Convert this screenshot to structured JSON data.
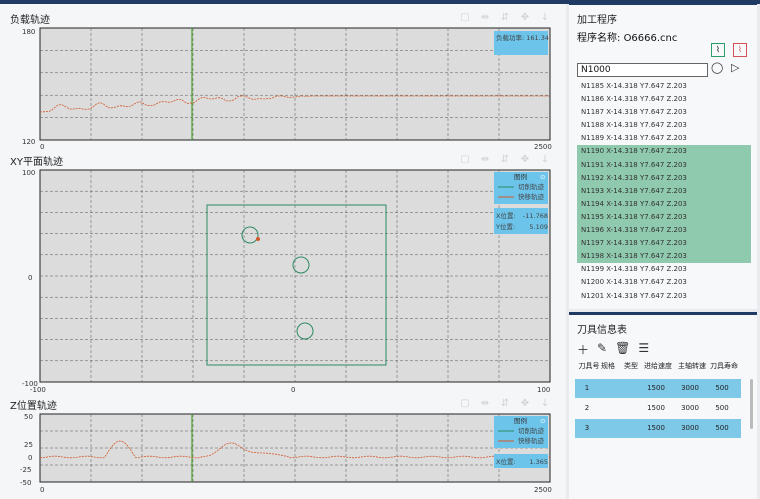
{
  "charts": [
    {
      "title": "负载轨迹",
      "ymax": "180",
      "ymin": "120",
      "xmin": "0",
      "xmax": "2500",
      "readout": "负载功率: 161.34"
    },
    {
      "title": "XY平面轨迹",
      "ymax": "100",
      "ymid": "0",
      "ymin": "-100",
      "xmin": "-100",
      "xmid": "0",
      "xmax": "100",
      "legend_title": "图例",
      "legend_cut": "切削轨迹",
      "legend_fast": "快移轨迹",
      "x_label": "X位置:",
      "x_value": "-11.768",
      "y_label": "Y位置:",
      "y_value": "5.109"
    },
    {
      "title": "Z位置轨迹",
      "ymax": "50",
      "y25": "25",
      "y0": "0",
      "yn25": "-25",
      "ymin": "-50",
      "xmin": "0",
      "xmax": "2500",
      "legend_title": "图例",
      "legend_cut": "切削轨迹",
      "legend_fast": "快移轨迹",
      "x_label": "X位置:",
      "x_value": "1.365"
    }
  ],
  "program": {
    "title": "加工程序",
    "name_label": "程序名称:",
    "name": "O6666.cnc",
    "search_value": "N1000",
    "lines": [
      {
        "text": "N1185 X-14.318 Y7.647 Z.203",
        "hl": false
      },
      {
        "text": "N1186 X-14.318 Y7.647 Z.203",
        "hl": false
      },
      {
        "text": "N1187 X-14.318 Y7.647 Z.203",
        "hl": false
      },
      {
        "text": "N1188 X-14.318 Y7.647 Z.203",
        "hl": false
      },
      {
        "text": "N1189 X-14.318 Y7.647 Z.203",
        "hl": false
      },
      {
        "text": "N1190 X-14.318 Y7.647 Z.203",
        "hl": true
      },
      {
        "text": "N1191 X-14.318 Y7.647 Z.203",
        "hl": true
      },
      {
        "text": "N1192 X-14.318 Y7.647 Z.203",
        "hl": true
      },
      {
        "text": "N1193 X-14.318 Y7.647 Z.203",
        "hl": true
      },
      {
        "text": "N1194 X-14.318 Y7.647 Z.203",
        "hl": true
      },
      {
        "text": "N1195 X-14.318 Y7.647 Z.203",
        "hl": true
      },
      {
        "text": "N1196 X-14.318 Y7.647 Z.203",
        "hl": true
      },
      {
        "text": "N1197 X-14.318 Y7.647 Z.203",
        "hl": true
      },
      {
        "text": "N1198 X-14.318 Y7.647 Z.203",
        "hl": true
      },
      {
        "text": "N1199 X-14.318 Y7.647 Z.203",
        "hl": false
      },
      {
        "text": "N1200 X-14.318 Y7.647 Z.203",
        "hl": false
      },
      {
        "text": "N1201 X-14.318 Y7.647 Z.203",
        "hl": false
      }
    ]
  },
  "tools": {
    "title": "刀具信息表",
    "headers": [
      "刀具号",
      "规格",
      "类型",
      "进给速度",
      "主轴转速",
      "刀具寿命"
    ],
    "rows": [
      {
        "id": "1",
        "feed": "1500",
        "spindle": "3000",
        "life": "500",
        "sel": true
      },
      {
        "id": "2",
        "feed": "1500",
        "spindle": "3000",
        "life": "500",
        "sel": false
      },
      {
        "id": "3",
        "feed": "1500",
        "spindle": "3000",
        "life": "500",
        "sel": true
      }
    ]
  },
  "colors": {
    "accent": "#1f3b63",
    "highlight": "#8fc9ae",
    "selected": "#7ec8e8",
    "trace": "#d2592a",
    "rect": "#2d8a63"
  }
}
